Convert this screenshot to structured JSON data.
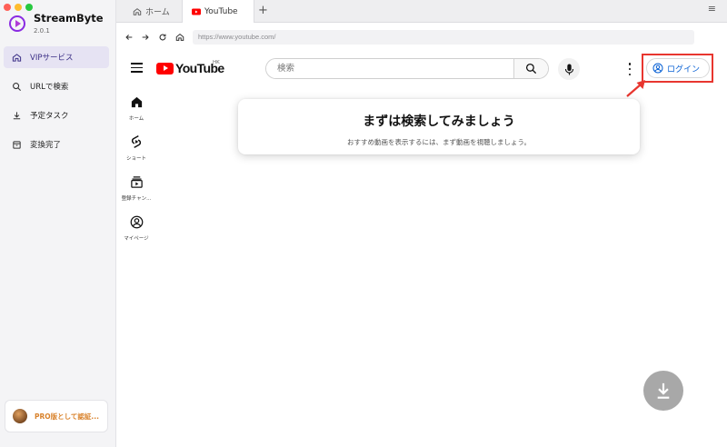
{
  "app": {
    "name": "StreamByte",
    "version": "2.0.1",
    "accent": "#3b2f86"
  },
  "window": {
    "traffic_lights": [
      "#ff5f57",
      "#febc2e",
      "#28c840"
    ]
  },
  "sidebar": {
    "items": [
      {
        "label": "VIPサービス",
        "icon": "home-icon",
        "active": true
      },
      {
        "label": "URLで検索",
        "icon": "search-icon",
        "active": false
      },
      {
        "label": "予定タスク",
        "icon": "download-icon",
        "active": false
      },
      {
        "label": "変換完了",
        "icon": "inbox-icon",
        "active": false
      }
    ],
    "pro_label": "PRO版として認証..."
  },
  "tabs": [
    {
      "label": "ホーム",
      "icon": "home-icon"
    },
    {
      "label": "YouTube",
      "icon": "youtube-icon",
      "active": true
    }
  ],
  "tab_add": "+",
  "tab_menu": "≡",
  "address": {
    "url": "https://www.youtube.com/"
  },
  "youtube": {
    "logo_text": "YouTube",
    "region": "HK",
    "search_placeholder": "検索",
    "login_label": "ログイン",
    "brand_red": "#ff0000",
    "login_blue": "#065fd4",
    "guide": [
      {
        "label": "ホーム",
        "icon": "home-filled-icon"
      },
      {
        "label": "ショート",
        "icon": "shorts-icon"
      },
      {
        "label": "登録チャン...",
        "icon": "subscriptions-icon"
      },
      {
        "label": "マイページ",
        "icon": "account-icon"
      }
    ],
    "card": {
      "title": "まずは検索してみましょう",
      "subtitle": "おすすめ動画を表示するには、まず動画を視聴しましょう。"
    }
  },
  "annotation": {
    "highlight_color": "#e8362f"
  }
}
